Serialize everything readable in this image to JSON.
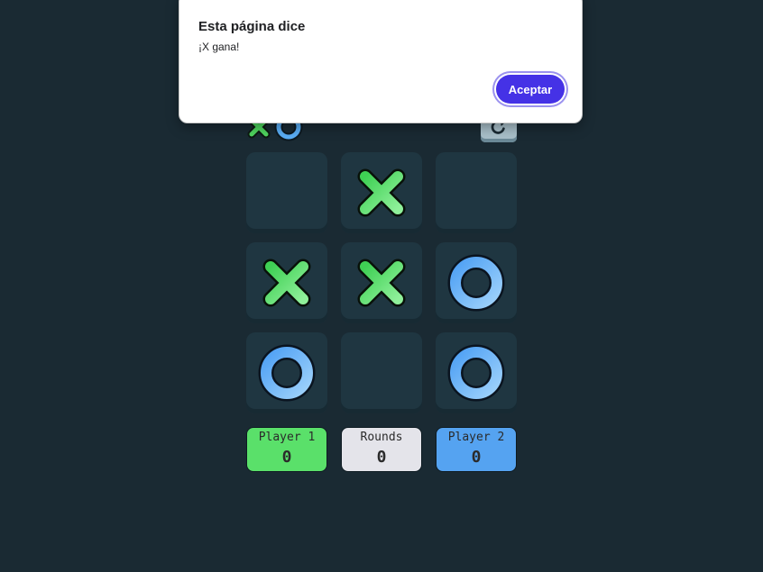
{
  "dialog": {
    "title": "Esta página dice",
    "message": "¡X gana!",
    "accept_label": "Aceptar"
  },
  "header": {
    "logo_marks": [
      "X",
      "O"
    ],
    "restart_icon": "restart-icon"
  },
  "board": {
    "cells": [
      "",
      "X",
      "",
      "X",
      "X",
      "O",
      "O",
      "",
      "O"
    ]
  },
  "scores": [
    {
      "label": "Player 1",
      "value": "0",
      "color": "#5ae06a"
    },
    {
      "label": "Rounds",
      "value": "0",
      "color": "#e4e4ea"
    },
    {
      "label": "Player 2",
      "value": "0",
      "color": "#55a3f1"
    }
  ],
  "colors": {
    "background": "#1a2a33",
    "cell": "#1f3641",
    "x_mark": "#4fd65f",
    "o_mark": "#5aaef6",
    "accent_button": "#4532e6"
  }
}
